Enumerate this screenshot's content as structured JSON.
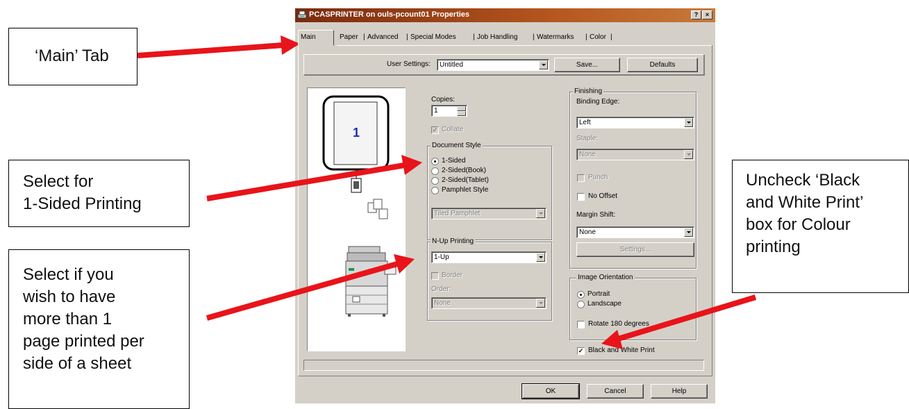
{
  "annotations": {
    "main_tab": "‘Main’ Tab",
    "one_sided": [
      "Select for",
      "1-Sided Printing"
    ],
    "nup": [
      "Select if you",
      "wish to have",
      "more than 1",
      "page printed per",
      "side of a sheet"
    ],
    "bw": [
      "Uncheck ‘Black",
      "and White Print’",
      "box for Colour",
      "printing"
    ]
  },
  "colors": {
    "arrow": "#e8141a",
    "title_bar": "#a0461a",
    "dialog_bg": "#d4d0c8"
  },
  "dialog": {
    "title": "PCASPRINTER on ouls-pcount01 Properties",
    "help_btn": "?",
    "close_btn": "×",
    "tabs": [
      "Main",
      "Paper",
      "Advanced",
      "Special Modes",
      "Job Handling",
      "Watermarks",
      "Color"
    ],
    "user_settings": {
      "label": "User Settings:",
      "value": "Untitled",
      "save": "Save...",
      "defaults": "Defaults"
    },
    "preview": {
      "page_number": "1"
    },
    "copies": {
      "label": "Copies:",
      "value": "1"
    },
    "collate": {
      "label": "Collate",
      "checked": true,
      "enabled": false
    },
    "document_style": {
      "label": "Document Style",
      "options": [
        "1-Sided",
        "2-Sided(Book)",
        "2-Sided(Tablet)",
        "Pamphlet Style"
      ],
      "selected": "1-Sided",
      "pamphlet_value": "Tiled Pamphlet"
    },
    "nup": {
      "label": "N-Up Printing",
      "value": "1-Up",
      "border": "Border",
      "order_label": "Order:",
      "order_value": "None"
    },
    "finishing": {
      "label": "Finishing",
      "binding_label": "Binding Edge:",
      "binding_value": "Left",
      "staple_label": "Staple:",
      "staple_value": "None",
      "punch": "Punch",
      "no_offset": "No Offset",
      "margin_label": "Margin Shift:",
      "margin_value": "None",
      "settings": "Settings..."
    },
    "orientation": {
      "label": "Image Orientation",
      "options": [
        "Portrait",
        "Landscape"
      ],
      "selected": "Portrait",
      "rotate": "Rotate 180 degrees"
    },
    "bw_print": {
      "label": "Black and White Print",
      "checked": true
    },
    "buttons": {
      "ok": "OK",
      "cancel": "Cancel",
      "help": "Help"
    }
  }
}
